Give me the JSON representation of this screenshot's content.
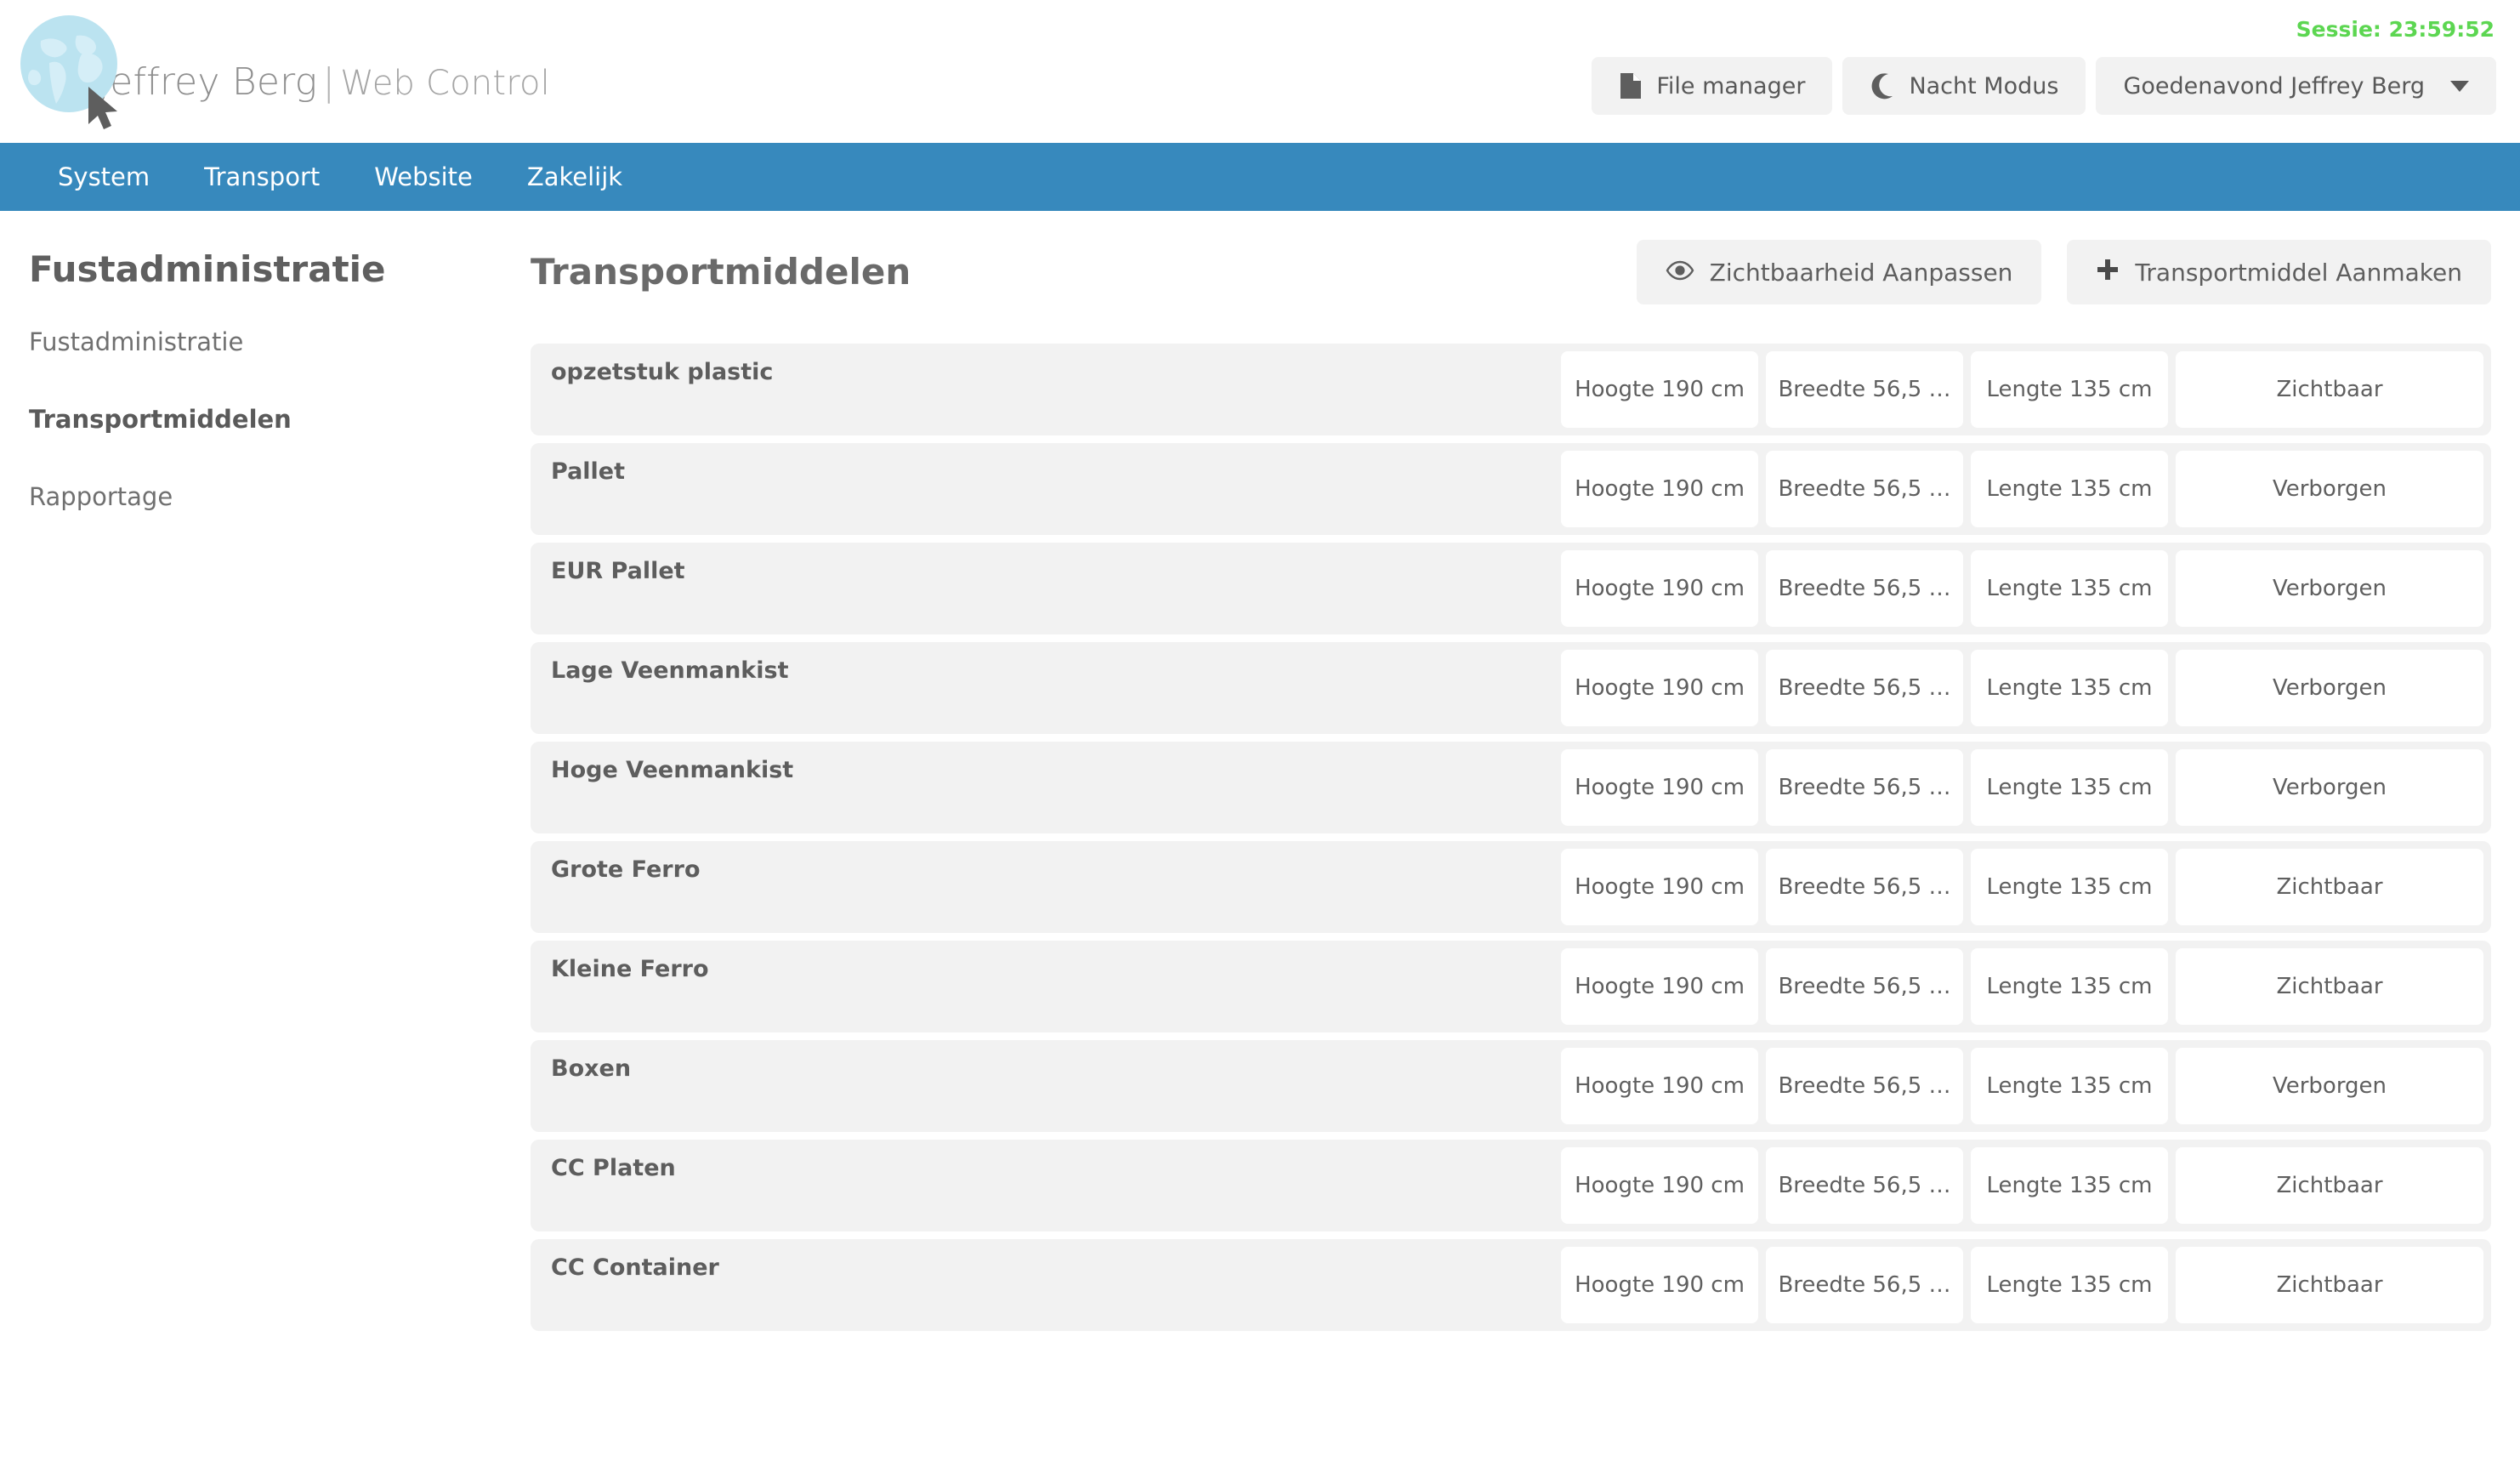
{
  "brand": {
    "logo_icon": "globe-icon",
    "cursor_icon": "cursor-arrow-icon",
    "name": "Jeffrey Berg",
    "separator": "|",
    "subtitle": "Web Control"
  },
  "header": {
    "session_label": "Sessie: 23:59:52",
    "session_color": "#5cd651",
    "buttons": [
      {
        "icon": "file-icon",
        "label": "File manager"
      },
      {
        "icon": "moon-icon",
        "label": "Nacht Modus"
      },
      {
        "icon": "chevron-down-icon",
        "label": "Goedenavond Jeffrey Berg"
      }
    ]
  },
  "nav": {
    "background": "#3789bd",
    "items": [
      {
        "label": "System"
      },
      {
        "label": "Transport"
      },
      {
        "label": "Website"
      },
      {
        "label": "Zakelijk"
      }
    ]
  },
  "sidebar": {
    "title": "Fustadministratie",
    "items": [
      {
        "label": "Fustadministratie",
        "active": false
      },
      {
        "label": "Transportmiddelen",
        "active": true
      },
      {
        "label": "Rapportage",
        "active": false
      }
    ]
  },
  "main": {
    "title": "Transportmiddelen",
    "actions": [
      {
        "icon": "eye-icon",
        "label": "Zichtbaarheid Aanpassen"
      },
      {
        "icon": "plus-icon",
        "label": "Transportmiddel Aanmaken"
      }
    ],
    "rows": [
      {
        "name": "opzetstuk plastic",
        "hoogte": "Hoogte 190 cm",
        "breedte": "Breedte 56,5 …",
        "lengte": "Lengte 135 cm",
        "status": "Zichtbaar"
      },
      {
        "name": "Pallet",
        "hoogte": "Hoogte 190 cm",
        "breedte": "Breedte 56,5 …",
        "lengte": "Lengte 135 cm",
        "status": "Verborgen"
      },
      {
        "name": "EUR Pallet",
        "hoogte": "Hoogte 190 cm",
        "breedte": "Breedte 56,5 …",
        "lengte": "Lengte 135 cm",
        "status": "Verborgen"
      },
      {
        "name": "Lage Veenmankist",
        "hoogte": "Hoogte 190 cm",
        "breedte": "Breedte 56,5 …",
        "lengte": "Lengte 135 cm",
        "status": "Verborgen"
      },
      {
        "name": "Hoge Veenmankist",
        "hoogte": "Hoogte 190 cm",
        "breedte": "Breedte 56,5 …",
        "lengte": "Lengte 135 cm",
        "status": "Verborgen"
      },
      {
        "name": "Grote Ferro",
        "hoogte": "Hoogte 190 cm",
        "breedte": "Breedte 56,5 …",
        "lengte": "Lengte 135 cm",
        "status": "Zichtbaar"
      },
      {
        "name": "Kleine Ferro",
        "hoogte": "Hoogte 190 cm",
        "breedte": "Breedte 56,5 …",
        "lengte": "Lengte 135 cm",
        "status": "Zichtbaar"
      },
      {
        "name": "Boxen",
        "hoogte": "Hoogte 190 cm",
        "breedte": "Breedte 56,5 …",
        "lengte": "Lengte 135 cm",
        "status": "Verborgen"
      },
      {
        "name": "CC Platen",
        "hoogte": "Hoogte 190 cm",
        "breedte": "Breedte 56,5 …",
        "lengte": "Lengte 135 cm",
        "status": "Zichtbaar"
      },
      {
        "name": "CC Container",
        "hoogte": "Hoogte 190 cm",
        "breedte": "Breedte 56,5 …",
        "lengte": "Lengte 135 cm",
        "status": "Zichtbaar"
      }
    ]
  }
}
